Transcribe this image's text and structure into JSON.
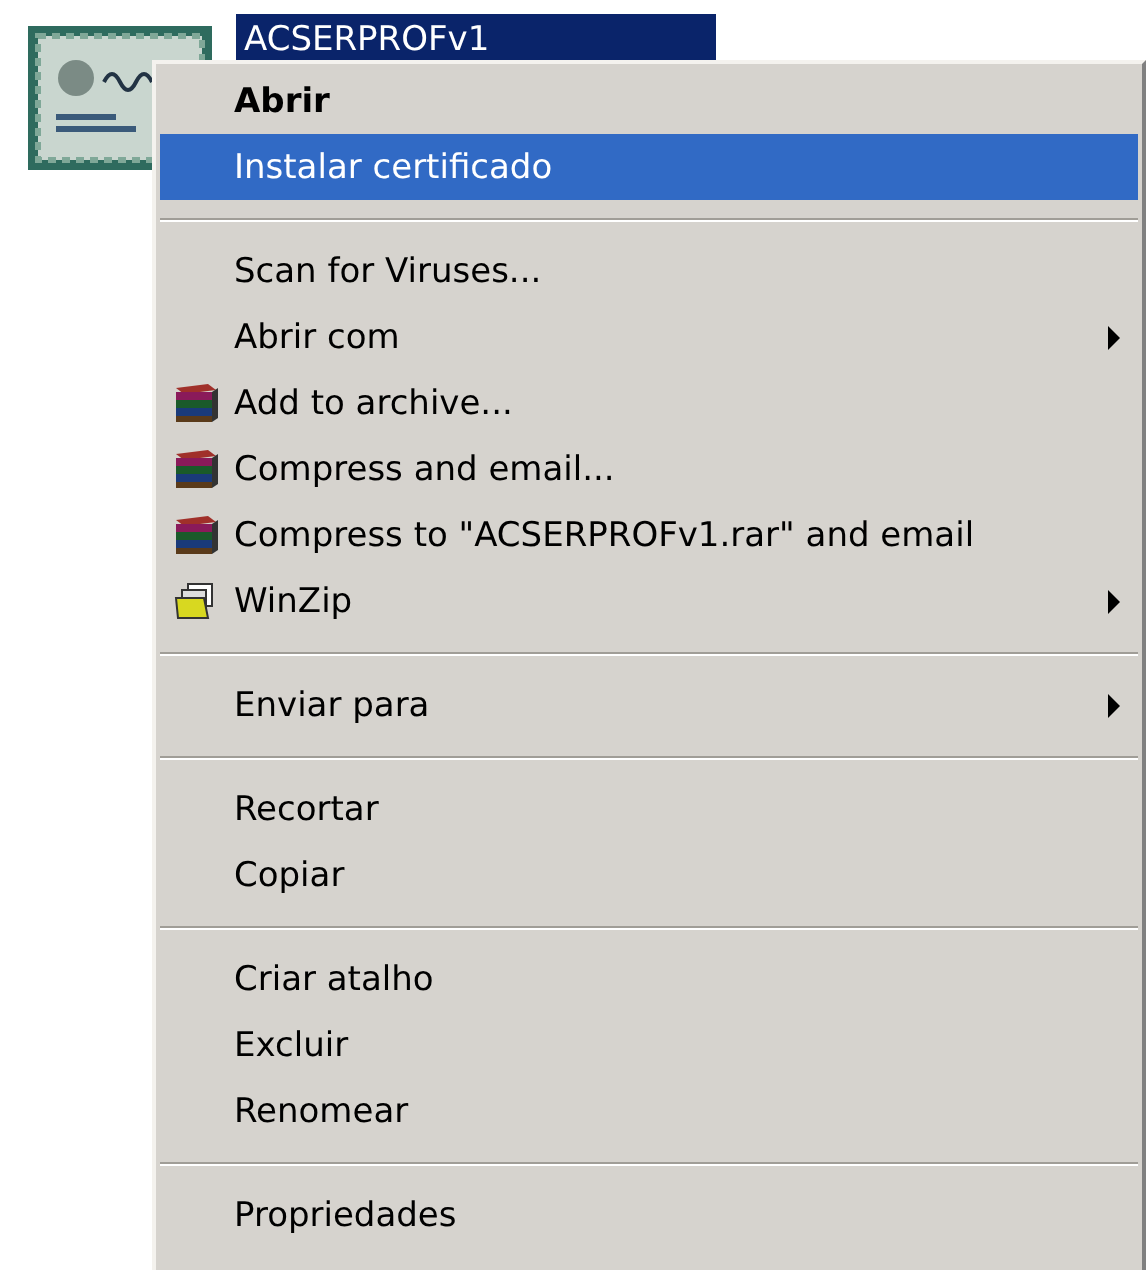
{
  "desktop_icon": {
    "label": "ACSERPROFv1",
    "selected": true
  },
  "context_menu": {
    "items": [
      {
        "kind": "item",
        "label": "Abrir",
        "bold": true,
        "selected": false,
        "submenu": false
      },
      {
        "kind": "item",
        "label": "Instalar certificado",
        "bold": false,
        "selected": true,
        "submenu": false
      },
      {
        "kind": "separator"
      },
      {
        "kind": "item",
        "label": "Scan for Viruses...",
        "bold": false,
        "selected": false,
        "submenu": false
      },
      {
        "kind": "item",
        "label": "Abrir com",
        "bold": false,
        "selected": false,
        "submenu": true
      },
      {
        "kind": "archive-item",
        "label": "Add to archive...",
        "bold": false,
        "selected": false,
        "submenu": false
      },
      {
        "kind": "archive-item",
        "label": "Compress and email...",
        "bold": false,
        "selected": false,
        "submenu": false
      },
      {
        "kind": "archive-item",
        "label": "Compress to \"ACSERPROFv1.rar\" and email",
        "bold": false,
        "selected": false,
        "submenu": false
      },
      {
        "kind": "winzip-item",
        "label": "WinZip",
        "bold": false,
        "selected": false,
        "submenu": true
      },
      {
        "kind": "separator"
      },
      {
        "kind": "item",
        "label": "Enviar para",
        "bold": false,
        "selected": false,
        "submenu": true
      },
      {
        "kind": "separator"
      },
      {
        "kind": "item",
        "label": "Recortar",
        "bold": false,
        "selected": false,
        "submenu": false
      },
      {
        "kind": "item",
        "label": "Copiar",
        "bold": false,
        "selected": false,
        "submenu": false
      },
      {
        "kind": "separator"
      },
      {
        "kind": "item",
        "label": "Criar atalho",
        "bold": false,
        "selected": false,
        "submenu": false
      },
      {
        "kind": "item",
        "label": "Excluir",
        "bold": false,
        "selected": false,
        "submenu": false
      },
      {
        "kind": "item",
        "label": "Renomear",
        "bold": false,
        "selected": false,
        "submenu": false
      },
      {
        "kind": "separator"
      },
      {
        "kind": "item",
        "label": "Propriedades",
        "bold": false,
        "selected": false,
        "submenu": false
      }
    ]
  }
}
